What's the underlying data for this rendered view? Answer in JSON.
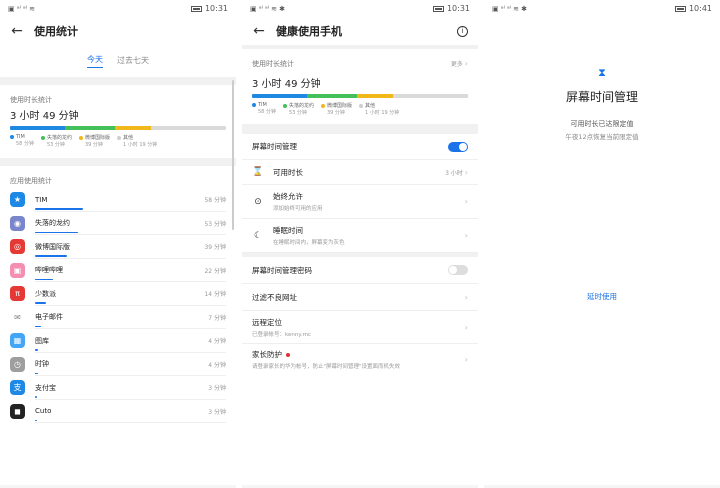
{
  "phone1": {
    "status": {
      "time": "10:31"
    },
    "title": "使用统计",
    "tabs": [
      {
        "label": "今天",
        "active": true
      },
      {
        "label": "过去七天",
        "active": false
      }
    ],
    "usage_label": "使用时长统计",
    "total_time": "3 小时 49 分钟",
    "segments": [
      {
        "name": "TIM",
        "value": 58,
        "color": "#1e88e5"
      },
      {
        "name": "失落的龙约",
        "value": 53,
        "color": "#43c05a"
      },
      {
        "name": "微博国际版",
        "value": 39,
        "color": "#f0b81a"
      },
      {
        "name": "其他",
        "value": 79,
        "color": "#dadada"
      }
    ],
    "legend": [
      {
        "name": "TIM",
        "sub": "58 分钟",
        "color": "#1e88e5"
      },
      {
        "name": "失落的龙约",
        "sub": "53 分钟",
        "color": "#43c05a"
      },
      {
        "name": "微博国际版",
        "sub": "39 分钟",
        "color": "#f0b81a"
      },
      {
        "name": "其他",
        "sub": "1 小时 19 分钟",
        "color": "#cfcfcf"
      }
    ],
    "app_section": "应用使用统计",
    "apps": [
      {
        "name": "TIM",
        "time": "58 分钟",
        "fraction": 0.3,
        "icon": "★",
        "color": "#1e88e5"
      },
      {
        "name": "失落的龙约",
        "time": "53 分钟",
        "fraction": 0.27,
        "icon": "◉",
        "color": "#7986cb"
      },
      {
        "name": "微博国际版",
        "time": "39 分钟",
        "fraction": 0.2,
        "icon": "◎",
        "color": "#e53935"
      },
      {
        "name": "哔哩哔哩",
        "time": "22 分钟",
        "fraction": 0.11,
        "icon": "▣",
        "color": "#f48fb1"
      },
      {
        "name": "少数派",
        "time": "14 分钟",
        "fraction": 0.07,
        "icon": "π",
        "color": "#e53935"
      },
      {
        "name": "电子邮件",
        "time": "7 分钟",
        "fraction": 0.035,
        "icon": "✉",
        "color": "#ffffff"
      },
      {
        "name": "图库",
        "time": "4 分钟",
        "fraction": 0.02,
        "icon": "▦",
        "color": "#42a5f5"
      },
      {
        "name": "时钟",
        "time": "4 分钟",
        "fraction": 0.02,
        "icon": "◷",
        "color": "#9e9e9e"
      },
      {
        "name": "支付宝",
        "time": "3 分钟",
        "fraction": 0.015,
        "icon": "支",
        "color": "#1e88e5"
      },
      {
        "name": "Cuto",
        "time": "3 分钟",
        "fraction": 0.015,
        "icon": "◼",
        "color": "#222222"
      }
    ]
  },
  "phone2": {
    "status": {
      "time": "10:31"
    },
    "title": "健康使用手机",
    "usage_label": "使用时长统计",
    "more": "更多",
    "total_time": "3 小时 49 分钟",
    "legend": [
      {
        "name": "TIM",
        "sub": "58 分钟",
        "color": "#1e88e5"
      },
      {
        "name": "失落的龙约",
        "sub": "53 分钟",
        "color": "#43c05a"
      },
      {
        "name": "微博国际版",
        "sub": "39 分钟",
        "color": "#f0b81a"
      },
      {
        "name": "其他",
        "sub": "1 小时 19 分钟",
        "color": "#cfcfcf"
      }
    ],
    "screen_time": "屏幕时间管理",
    "screen_time_on": true,
    "available": "可用时长",
    "available_val": "3 小时",
    "always_allow": "始终允许",
    "always_allow_sub": "添加始终可用的应用",
    "bedtime": "睡眠时间",
    "bedtime_sub": "在睡眠时间内，屏幕变为灰色",
    "password": "屏幕时间管理密码",
    "password_on": false,
    "filter": "过滤不良网址",
    "locate": "远程定位",
    "locate_sub": "已登录帐号：kenny.mc",
    "parental": "家长防护",
    "parental_sub": "请登录家长的华为帐号，防止\"屏幕时间管理\"设置面而机失效"
  },
  "phone3": {
    "status": {
      "time": "10:41"
    },
    "title": "屏幕时间管理",
    "sub": "可用时长已达限定值",
    "sub2": "午夜12点恢复当前限定值",
    "delay": "延时使用"
  }
}
